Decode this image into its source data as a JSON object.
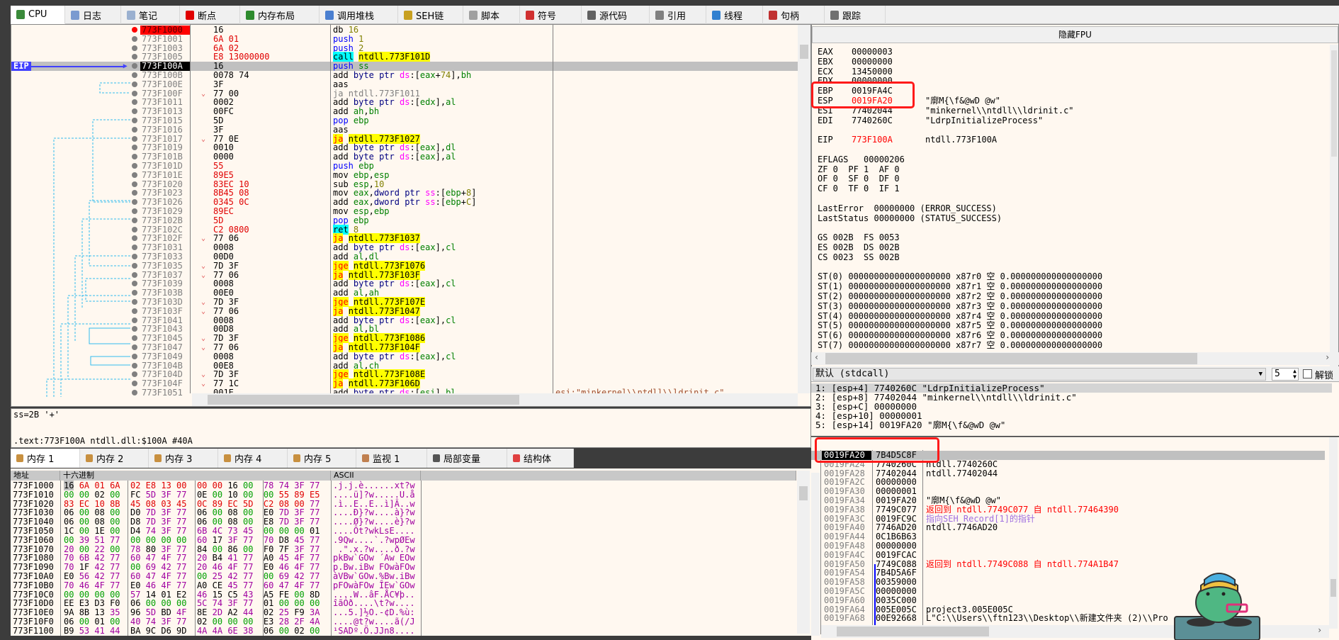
{
  "main_tabs": [
    {
      "label": "CPU",
      "icon": "cpu-icon",
      "color": "#3a8a3a"
    },
    {
      "label": "日志",
      "icon": "log-icon",
      "color": "#7a9ad0"
    },
    {
      "label": "笔记",
      "icon": "notes-icon",
      "color": "#9ab0d0"
    },
    {
      "label": "断点",
      "icon": "breakpoint-icon",
      "color": "#e00000"
    },
    {
      "label": "内存布局",
      "icon": "memory-map-icon",
      "color": "#2e8b2e"
    },
    {
      "label": "调用堆栈",
      "icon": "call-stack-icon",
      "color": "#4a7fd0"
    },
    {
      "label": "SEH链",
      "icon": "seh-icon",
      "color": "#c8a020"
    },
    {
      "label": "脚本",
      "icon": "script-icon",
      "color": "#a0a0a0"
    },
    {
      "label": "符号",
      "icon": "symbol-icon",
      "color": "#d03030"
    },
    {
      "label": "源代码",
      "icon": "source-icon",
      "color": "#606060"
    },
    {
      "label": "引用",
      "icon": "references-icon",
      "color": "#808080"
    },
    {
      "label": "线程",
      "icon": "threads-icon",
      "color": "#3080d0"
    },
    {
      "label": "句柄",
      "icon": "handles-icon",
      "color": "#c03030"
    },
    {
      "label": "跟踪",
      "icon": "trace-icon",
      "color": "#707070"
    }
  ],
  "disasm": {
    "eip_label": "EIP",
    "rows": [
      {
        "addr": "773F1000",
        "bytes": "16",
        "mn": "db",
        "ops": "16",
        "kind": "db",
        "bp": true
      },
      {
        "addr": "773F1001",
        "bytes": "6A 01",
        "mn": "push",
        "ops": "1",
        "kind": "push",
        "red": true
      },
      {
        "addr": "773F1003",
        "bytes": "6A 02",
        "mn": "push",
        "ops": "2",
        "kind": "push",
        "red": true
      },
      {
        "addr": "773F1005",
        "bytes": "E8 13000000",
        "mn": "call",
        "ops": "ntdll.773F101D",
        "kind": "call",
        "red": true
      },
      {
        "addr": "773F100A",
        "bytes": "16",
        "mn": "push",
        "ops": "ss",
        "kind": "push",
        "eip": true
      },
      {
        "addr": "773F100B",
        "bytes": "0078 74",
        "mn": "add",
        "ops": "byte ptr ds:[eax+74],bh",
        "kind": "normal"
      },
      {
        "addr": "773F100E",
        "bytes": "3F",
        "mn": "aas",
        "ops": "",
        "kind": "normal"
      },
      {
        "addr": "773F100F",
        "bytes": "77 00",
        "mn": "ja",
        "ops": "ntdll.773F1011",
        "kind": "jgrey",
        "jump": true
      },
      {
        "addr": "773F1011",
        "bytes": "0002",
        "mn": "add",
        "ops": "byte ptr ds:[edx],al",
        "kind": "normal"
      },
      {
        "addr": "773F1013",
        "bytes": "00FC",
        "mn": "add",
        "ops": "ah,bh",
        "kind": "normal"
      },
      {
        "addr": "773F1015",
        "bytes": "5D",
        "mn": "pop",
        "ops": "ebp",
        "kind": "push"
      },
      {
        "addr": "773F1016",
        "bytes": "3F",
        "mn": "aas",
        "ops": "",
        "kind": "normal"
      },
      {
        "addr": "773F1017",
        "bytes": "77 0E",
        "mn": "ja",
        "ops": "ntdll.773F1027",
        "kind": "jcc",
        "jump": true
      },
      {
        "addr": "773F1019",
        "bytes": "0010",
        "mn": "add",
        "ops": "byte ptr ds:[eax],dl",
        "kind": "normal"
      },
      {
        "addr": "773F101B",
        "bytes": "0000",
        "mn": "add",
        "ops": "byte ptr ds:[eax],al",
        "kind": "normal"
      },
      {
        "addr": "773F101D",
        "bytes": "55",
        "mn": "push",
        "ops": "ebp",
        "kind": "push",
        "red": true
      },
      {
        "addr": "773F101E",
        "bytes": "89E5",
        "mn": "mov",
        "ops": "ebp,esp",
        "kind": "normal",
        "red": true
      },
      {
        "addr": "773F1020",
        "bytes": "83EC 10",
        "mn": "sub",
        "ops": "esp,10",
        "kind": "normal",
        "red": true
      },
      {
        "addr": "773F1023",
        "bytes": "8B45 08",
        "mn": "mov",
        "ops": "eax,dword ptr ss:[ebp+8]",
        "kind": "normal",
        "red": true
      },
      {
        "addr": "773F1026",
        "bytes": "0345 0C",
        "mn": "add",
        "ops": "eax,dword ptr ss:[ebp+C]",
        "kind": "normal",
        "red": true
      },
      {
        "addr": "773F1029",
        "bytes": "89EC",
        "mn": "mov",
        "ops": "esp,ebp",
        "kind": "normal",
        "red": true
      },
      {
        "addr": "773F102B",
        "bytes": "5D",
        "mn": "pop",
        "ops": "ebp",
        "kind": "push",
        "red": true
      },
      {
        "addr": "773F102C",
        "bytes": "C2 0800",
        "mn": "ret",
        "ops": "8",
        "kind": "call",
        "red": true
      },
      {
        "addr": "773F102F",
        "bytes": "77 06",
        "mn": "ja",
        "ops": "ntdll.773F1037",
        "kind": "jcc",
        "jump": true
      },
      {
        "addr": "773F1031",
        "bytes": "0008",
        "mn": "add",
        "ops": "byte ptr ds:[eax],cl",
        "kind": "normal"
      },
      {
        "addr": "773F1033",
        "bytes": "00D0",
        "mn": "add",
        "ops": "al,dl",
        "kind": "normal"
      },
      {
        "addr": "773F1035",
        "bytes": "7D 3F",
        "mn": "jge",
        "ops": "ntdll.773F1076",
        "kind": "jcc",
        "jump": true
      },
      {
        "addr": "773F1037",
        "bytes": "77 06",
        "mn": "ja",
        "ops": "ntdll.773F103F",
        "kind": "jcc",
        "jump": true
      },
      {
        "addr": "773F1039",
        "bytes": "0008",
        "mn": "add",
        "ops": "byte ptr ds:[eax],cl",
        "kind": "normal"
      },
      {
        "addr": "773F103B",
        "bytes": "00E0",
        "mn": "add",
        "ops": "al,ah",
        "kind": "normal"
      },
      {
        "addr": "773F103D",
        "bytes": "7D 3F",
        "mn": "jge",
        "ops": "ntdll.773F107E",
        "kind": "jcc",
        "jump": true
      },
      {
        "addr": "773F103F",
        "bytes": "77 06",
        "mn": "ja",
        "ops": "ntdll.773F1047",
        "kind": "jcc",
        "jump": true
      },
      {
        "addr": "773F1041",
        "bytes": "0008",
        "mn": "add",
        "ops": "byte ptr ds:[eax],cl",
        "kind": "normal"
      },
      {
        "addr": "773F1043",
        "bytes": "00D8",
        "mn": "add",
        "ops": "al,bl",
        "kind": "normal"
      },
      {
        "addr": "773F1045",
        "bytes": "7D 3F",
        "mn": "jge",
        "ops": "ntdll.773F1086",
        "kind": "jcc",
        "jump": true
      },
      {
        "addr": "773F1047",
        "bytes": "77 06",
        "mn": "ja",
        "ops": "ntdll.773F104F",
        "kind": "jcc",
        "jump": true
      },
      {
        "addr": "773F1049",
        "bytes": "0008",
        "mn": "add",
        "ops": "byte ptr ds:[eax],cl",
        "kind": "normal"
      },
      {
        "addr": "773F104B",
        "bytes": "00E8",
        "mn": "add",
        "ops": "al,ch",
        "kind": "normal"
      },
      {
        "addr": "773F104D",
        "bytes": "7D 3F",
        "mn": "jge",
        "ops": "ntdll.773F108E",
        "kind": "jcc",
        "jump": true
      },
      {
        "addr": "773F104F",
        "bytes": "77 1C",
        "mn": "ja",
        "ops": "ntdll.773F106D",
        "kind": "jcc",
        "jump": true
      },
      {
        "addr": "773F1051",
        "bytes": "001E",
        "mn": "add",
        "ops": "byte ptr ds:[esi],bl",
        "kind": "normal",
        "comment": "esi:\"minkernel\\\\ntdll\\\\ldrinit.c\""
      }
    ]
  },
  "info": {
    "line1": "ss=2B '+'",
    "line2": ".text:773F100A ntdll.dll:$100A #40A"
  },
  "mem_tabs": [
    {
      "label": "内存 1",
      "icon": "memory-icon"
    },
    {
      "label": "内存 2",
      "icon": "memory-icon"
    },
    {
      "label": "内存 3",
      "icon": "memory-icon"
    },
    {
      "label": "内存 4",
      "icon": "memory-icon"
    },
    {
      "label": "内存 5",
      "icon": "memory-icon"
    },
    {
      "label": "监视 1",
      "icon": "watch-icon"
    },
    {
      "label": "局部变量",
      "icon": "locals-icon"
    },
    {
      "label": "结构体",
      "icon": "struct-icon"
    }
  ],
  "dump": {
    "headers": {
      "addr": "地址",
      "hex": "十六进制",
      "ascii": "ASCII"
    },
    "rows": [
      {
        "addr": "773F1000",
        "hex": "16 6A 01 6A 02 E8 13 00 00 00 16 00 78 74 3F 77",
        "ascii": ".j.j.è......xt?w"
      },
      {
        "addr": "773F1010",
        "hex": "00 00 02 00 FC 5D 3F 77 0E 00 10 00 00 55 89 E5",
        "ascii": "....ü]?w.....U.å"
      },
      {
        "addr": "773F1020",
        "hex": "83 EC 10 8B 45 08 03 45 0C 89 EC 5D C2 08 00 77",
        "ascii": ".ì..E..E..ì]Â..w"
      },
      {
        "addr": "773F1030",
        "hex": "06 00 08 00 D0 7D 3F 77 06 00 08 00 E0 7D 3F 77",
        "ascii": "....Ð}?w....à}?w"
      },
      {
        "addr": "773F1040",
        "hex": "06 00 08 00 D8 7D 3F 77 06 00 08 00 E8 7D 3F 77",
        "ascii": "....Ø}?w....è}?w"
      },
      {
        "addr": "773F1050",
        "hex": "1C 00 1E 00 D4 74 3F 77 6B 4C 73 45 00 00 00 01",
        "ascii": "....Ôt?wkLsE...."
      },
      {
        "addr": "773F1060",
        "hex": "00 39 51 77 00 00 00 00 60 17 3F 77 70 D8 45 77",
        "ascii": ".9Qw....`.?wpØEw"
      },
      {
        "addr": "773F1070",
        "hex": "20 00 22 00 78 80 3F 77 84 00 86 00 F0 7F 3F 77",
        "ascii": " .\".x.?w....ð.?w"
      },
      {
        "addr": "773F1080",
        "hex": "70 6B 42 77 60 47 4F 77 20 B4 41 77 A0 45 4F 77",
        "ascii": "pkBw`GOw ´Aw EOw"
      },
      {
        "addr": "773F1090",
        "hex": "70 1F 42 77 00 69 42 77 20 46 4F 77 E0 46 4F 77",
        "ascii": "p.Bw.iBw FOwàFOw"
      },
      {
        "addr": "773F10A0",
        "hex": "E0 56 42 77 60 47 4F 77 00 25 42 77 00 69 42 77",
        "ascii": "àVBw`GOw.%Bw.iBw"
      },
      {
        "addr": "773F10B0",
        "hex": "70 46 4F 77 E0 46 4F 77 A0 CE 45 77 60 47 4F 77",
        "ascii": "pFOwàFOw ÎEw`GOw"
      },
      {
        "addr": "773F10C0",
        "hex": "00 00 00 00 57 14 01 E2 46 15 C5 43 A5 FE 00 8D",
        "ascii": "....W..âF.ÅC¥þ.."
      },
      {
        "addr": "773F10D0",
        "hex": "EE E3 D3 F0 06 00 00 00 5C 74 3F 77 01 00 00 00",
        "ascii": "îãÓð....\\t?w...."
      },
      {
        "addr": "773F10E0",
        "hex": "9A 8B 13 35 96 5D BD 4F 8E 2D A2 44 02 25 F9 3A",
        "ascii": "...5.]½O.-¢D.%ù:"
      },
      {
        "addr": "773F10F0",
        "hex": "06 00 01 00 40 74 3F 77 02 00 00 00 E3 28 2F 4A",
        "ascii": "....@t?w....ã(/J"
      },
      {
        "addr": "773F1100",
        "hex": "B9 53 41 44 BA 9C D6 9D 4A 4A 6E 38 06 00 02 00",
        "ascii": "¹SADº.Ö.JJn8...."
      }
    ]
  },
  "registers": {
    "header_button": "隐藏FPU",
    "lines": [
      {
        "name": "EAX",
        "value": "00000003"
      },
      {
        "name": "EBX",
        "value": "00000000"
      },
      {
        "name": "ECX",
        "value": "13450000"
      },
      {
        "name": "EDX",
        "value": "00000000"
      },
      {
        "name": "EBP",
        "value": "0019FA4C"
      },
      {
        "name": "ESP",
        "value": "0019FA20",
        "changed": true,
        "comment": "\"廓M{\\f&@wD @w\""
      },
      {
        "name": "ESI",
        "value": "77402044",
        "comment": "\"minkernel\\\\ntdll\\\\ldrinit.c\""
      },
      {
        "name": "EDI",
        "value": "7740260C",
        "comment": "\"LdrpInitializeProcess\""
      },
      {},
      {
        "name": "EIP",
        "value": "773F100A",
        "changed": true,
        "comment": "ntdll.773F100A"
      },
      {},
      {
        "text": "EFLAGS   00000206"
      },
      {
        "text": "ZF 0  PF 1  AF 0"
      },
      {
        "text": "OF 0  SF 0  DF 0"
      },
      {
        "text": "CF 0  TF 0  IF 1"
      },
      {},
      {
        "text": "LastError  00000000 (ERROR_SUCCESS)"
      },
      {
        "text": "LastStatus 00000000 (STATUS_SUCCESS)"
      },
      {},
      {
        "text": "GS 002B  FS 0053"
      },
      {
        "text": "ES 002B  DS 002B"
      },
      {
        "text": "CS 0023  SS 002B"
      },
      {},
      {
        "text": "ST(0) 00000000000000000000 x87r0 空 0.000000000000000000"
      },
      {
        "text": "ST(1) 00000000000000000000 x87r1 空 0.000000000000000000"
      },
      {
        "text": "ST(2) 00000000000000000000 x87r2 空 0.000000000000000000"
      },
      {
        "text": "ST(3) 00000000000000000000 x87r3 空 0.000000000000000000"
      },
      {
        "text": "ST(4) 00000000000000000000 x87r4 空 0.000000000000000000"
      },
      {
        "text": "ST(5) 00000000000000000000 x87r5 空 0.000000000000000000"
      },
      {
        "text": "ST(6) 00000000000000000000 x87r6 空 0.000000000000000000"
      },
      {
        "text": "ST(7) 00000000000000000000 x87r7 空 0.000000000000000000"
      }
    ]
  },
  "callconv": {
    "selected": "默认 (stdcall)",
    "arg_count": "5",
    "unlock_label": "解锁",
    "args": [
      "1: [esp+4] 7740260C \"LdrpInitializeProcess\"",
      "2: [esp+8] 77402044 \"minkernel\\\\ntdll\\\\ldrinit.c\"",
      "3: [esp+C] 00000000",
      "4: [esp+10] 00000001",
      "5: [esp+14] 0019FA20 \"廓M{\\f&@wD @w\""
    ]
  },
  "stack": {
    "rows": [
      {
        "addr": "0019FA20",
        "value": "7B4D5C8F",
        "comment": ""
      },
      {
        "addr": "0019FA24",
        "value": "7740260C",
        "comment": "ntdll.7740260C"
      },
      {
        "addr": "0019FA28",
        "value": "77402044",
        "comment": "ntdll.77402044"
      },
      {
        "addr": "0019FA2C",
        "value": "00000000",
        "comment": ""
      },
      {
        "addr": "0019FA30",
        "value": "00000001",
        "comment": ""
      },
      {
        "addr": "0019FA34",
        "value": "0019FA20",
        "comment": "\"廓M{\\f&@wD @w\""
      },
      {
        "addr": "0019FA38",
        "value": "7749C077",
        "comment": "返回到 ntdll.7749C077 自 ntdll.77464390",
        "type": "return"
      },
      {
        "addr": "0019FA3C",
        "value": "0019FC9C",
        "comment": "指向SEH_Record[1]的指针",
        "type": "seh"
      },
      {
        "addr": "0019FA40",
        "value": "7746AD20",
        "comment": "ntdll.7746AD20"
      },
      {
        "addr": "0019FA44",
        "value": "0C1B6B63",
        "comment": ""
      },
      {
        "addr": "0019FA48",
        "value": "00000000",
        "comment": ""
      },
      {
        "addr": "0019FA4C",
        "value": "0019FCAC",
        "comment": ""
      },
      {
        "addr": "0019FA50",
        "value": "7749C088",
        "comment": "返回到 ntdll.7749C088 自 ntdll.774A1B47",
        "type": "return"
      },
      {
        "addr": "0019FA54",
        "value": "7B4D5A6F",
        "comment": ""
      },
      {
        "addr": "0019FA58",
        "value": "00359000",
        "comment": ""
      },
      {
        "addr": "0019FA5C",
        "value": "00000000",
        "comment": ""
      },
      {
        "addr": "0019FA60",
        "value": "0035C000",
        "comment": ""
      },
      {
        "addr": "0019FA64",
        "value": "005E005C",
        "comment": "project3.005E005C"
      },
      {
        "addr": "0019FA68",
        "value": "00E92668",
        "comment": "L\"C:\\\\Users\\\\ftn123\\\\Desktop\\\\新建文件夹 (2)\\\\Pro"
      }
    ]
  },
  "colors": {
    "pane_bg": "#fff8f0",
    "highlight_box": "#ff1a1a",
    "jump_bg": "#ffff00",
    "call_bg": "#00ffff",
    "eip_label_bg": "#4040ff",
    "changed": "#ff0000"
  }
}
